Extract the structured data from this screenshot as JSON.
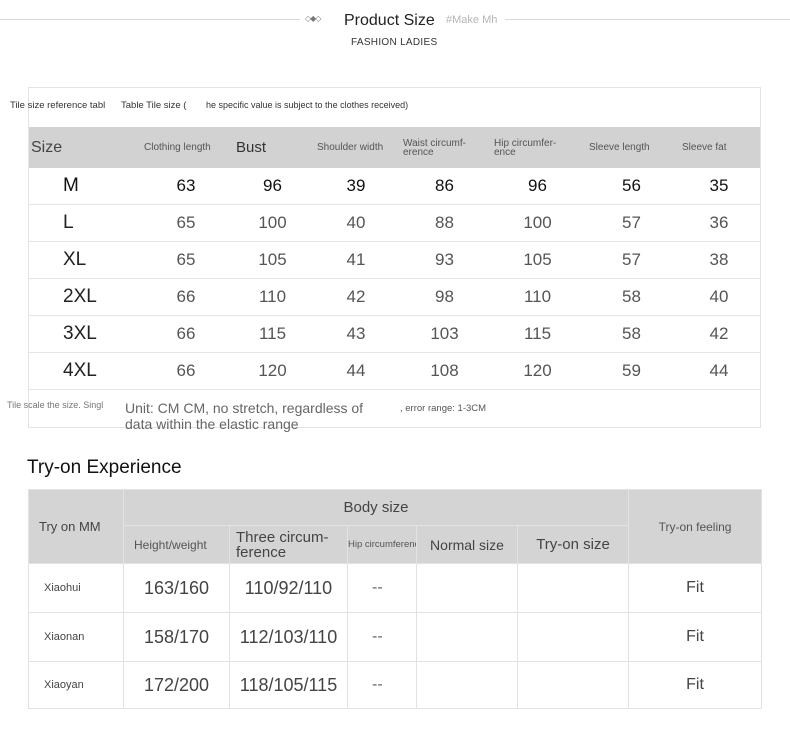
{
  "header": {
    "title": "Product Size",
    "make": "#Make Mh",
    "subtitle": "FASHION LADIES",
    "diamonds": "◇◆◇"
  },
  "size_table": {
    "note_prefix": "Tile size reference tabl",
    "note_label": "Table Tile size (",
    "note_text": "he specific value is subject to the clothes received)",
    "headers": [
      "Size",
      "Clothing length",
      "Bust",
      "Shoulder width",
      "Waist circumf-\nerence",
      "Hip circumfer-\nence",
      "Sleeve length",
      "Sleeve fat"
    ],
    "rows": [
      [
        "M",
        "63",
        "96",
        "39",
        "86",
        "96",
        "56",
        "35"
      ],
      [
        "L",
        "65",
        "100",
        "40",
        "88",
        "100",
        "57",
        "36"
      ],
      [
        "XL",
        "65",
        "105",
        "41",
        "93",
        "105",
        "57",
        "38"
      ],
      [
        "2XL",
        "66",
        "110",
        "42",
        "98",
        "110",
        "58",
        "40"
      ],
      [
        "3XL",
        "66",
        "115",
        "43",
        "103",
        "115",
        "58",
        "42"
      ],
      [
        "4XL",
        "66",
        "120",
        "44",
        "108",
        "120",
        "59",
        "44"
      ]
    ],
    "footer_prefix": "Tile scale the size. Singl",
    "unit_text": "Unit: CM CM, no stretch, regardless of\ndata within the elastic range",
    "error_range": ", error range: 1-3CM"
  },
  "tryon": {
    "title": "Try-on Experience",
    "try_on_mm": "Try on MM",
    "body_size": "Body size",
    "try_on_feeling": "Try-on feeling",
    "subheaders": [
      "Height/weight",
      "Three circum-\nference",
      "Hip circumference",
      "Normal size",
      "Try-on size"
    ],
    "rows": [
      {
        "name": "Xiaohui",
        "height_weight": "163/160",
        "three": "110/92/110",
        "hip": "--",
        "normal": "",
        "tryon": "",
        "feeling": "Fit"
      },
      {
        "name": "Xiaonan",
        "height_weight": "158/170",
        "three": "112/103/110",
        "hip": "--",
        "normal": "",
        "tryon": "",
        "feeling": "Fit"
      },
      {
        "name": "Xiaoyan",
        "height_weight": "172/200",
        "three": "118/105/115",
        "hip": "--",
        "normal": "",
        "tryon": "",
        "feeling": "Fit"
      }
    ]
  }
}
